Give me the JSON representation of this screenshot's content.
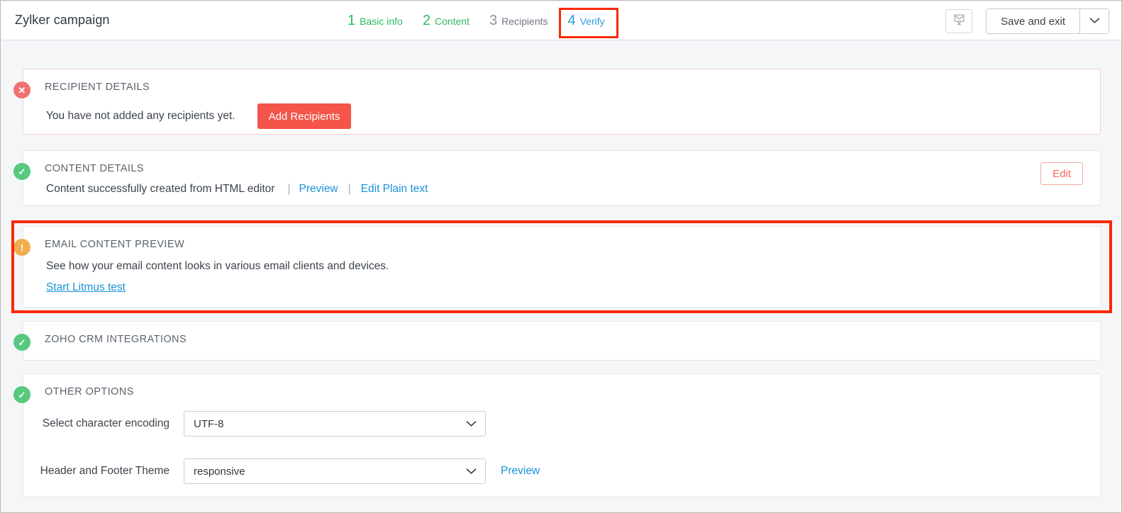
{
  "header": {
    "campaign_title": "Zylker campaign",
    "steps": [
      {
        "num": "1",
        "label": "Basic info",
        "state": "done"
      },
      {
        "num": "2",
        "label": "Content",
        "state": "done"
      },
      {
        "num": "3",
        "label": "Recipients",
        "state": "todo"
      },
      {
        "num": "4",
        "label": "Verify",
        "state": "active"
      }
    ],
    "test_email_icon": "envelope-test-icon",
    "save_and_exit_label": "Save and exit",
    "save_dropdown_icon": "chevron-down-icon"
  },
  "sections": {
    "recipient_details": {
      "title": "RECIPIENT DETAILS",
      "status": "error",
      "status_icon": "x-circle-icon",
      "message": "You have not added any recipients yet.",
      "button_label": "Add Recipients"
    },
    "content_details": {
      "title": "CONTENT DETAILS",
      "status": "ok",
      "status_icon": "check-circle-icon",
      "message": "Content successfully created from HTML editor",
      "separator": "|",
      "preview_link": "Preview",
      "edit_plain_text_link": "Edit Plain text",
      "edit_button_label": "Edit"
    },
    "email_content_preview": {
      "title": "EMAIL CONTENT PREVIEW",
      "status": "warning",
      "status_icon": "exclamation-circle-icon",
      "message": "See how your email content looks in various email clients and devices.",
      "link": "Start Litmus test",
      "highlighted": true
    },
    "zoho_crm_integrations": {
      "title": "ZOHO CRM INTEGRATIONS",
      "status": "ok",
      "status_icon": "check-circle-icon"
    },
    "other_options": {
      "title": "OTHER OPTIONS",
      "status": "ok",
      "status_icon": "check-circle-icon",
      "fields": [
        {
          "label": "Select character encoding",
          "value": "UTF-8",
          "icon": "chevron-down-icon"
        },
        {
          "label": "Header and Footer Theme",
          "value": "responsive",
          "icon": "chevron-down-icon",
          "side_link": "Preview"
        }
      ]
    }
  },
  "colors": {
    "accent_red": "#f4544a",
    "highlight_red": "#fa2900",
    "success_green": "#2cbb5d",
    "active_blue": "#2d9cdb",
    "link_blue": "#1a93d8",
    "warning_orange": "#f0ad4e",
    "error_red": "#ef7272",
    "page_bg": "#f4f6f8"
  }
}
